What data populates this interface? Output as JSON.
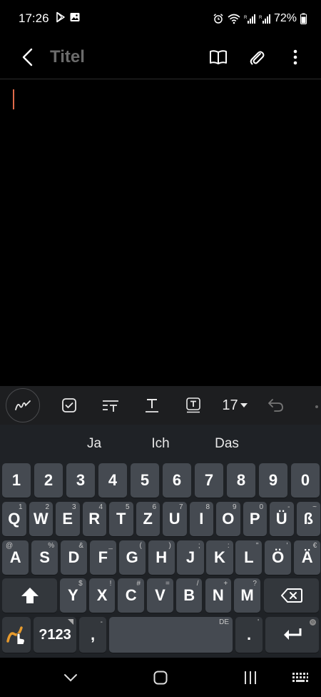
{
  "status": {
    "time": "17:26",
    "battery": "72%"
  },
  "app_bar": {
    "title": "Titel"
  },
  "toolbar": {
    "font_size": "17"
  },
  "keyboard": {
    "suggestions": [
      "Ja",
      "Ich",
      "Das"
    ],
    "rows": [
      [
        {
          "k": "1"
        },
        {
          "k": "2"
        },
        {
          "k": "3"
        },
        {
          "k": "4"
        },
        {
          "k": "5"
        },
        {
          "k": "6"
        },
        {
          "k": "7"
        },
        {
          "k": "8"
        },
        {
          "k": "9"
        },
        {
          "k": "0"
        }
      ],
      [
        {
          "k": "Q",
          "h": "1"
        },
        {
          "k": "W",
          "h": "2"
        },
        {
          "k": "E",
          "h": "3"
        },
        {
          "k": "R",
          "h": "4"
        },
        {
          "k": "T",
          "h": "5"
        },
        {
          "k": "Z",
          "h": "6"
        },
        {
          "k": "U",
          "h": "7"
        },
        {
          "k": "I",
          "h": "8"
        },
        {
          "k": "O",
          "h": "9"
        },
        {
          "k": "P",
          "h": "0"
        },
        {
          "k": "Ü",
          "h": "-"
        },
        {
          "k": "ß",
          "h": "~"
        }
      ],
      [
        {
          "k": "A",
          "hl": "@"
        },
        {
          "k": "S",
          "h": "%"
        },
        {
          "k": "D",
          "h": "&"
        },
        {
          "k": "F",
          "h": "_"
        },
        {
          "k": "G",
          "h": "("
        },
        {
          "k": "H",
          "h": ")"
        },
        {
          "k": "J",
          "h": ";"
        },
        {
          "k": "K",
          "h": ":"
        },
        {
          "k": "L",
          "h": "\""
        },
        {
          "k": "Ö",
          "h": "'"
        },
        {
          "k": "Ä",
          "h": "€"
        }
      ],
      [
        {
          "k": "Y",
          "h": "$"
        },
        {
          "k": "X",
          "h": "!"
        },
        {
          "k": "C",
          "h": "#"
        },
        {
          "k": "V",
          "h": "="
        },
        {
          "k": "B",
          "h": "/"
        },
        {
          "k": "N",
          "h": "+"
        },
        {
          "k": "M",
          "h": "?"
        }
      ]
    ],
    "sym_key": "?123",
    "comma_key": ",",
    "comma_hint": "-",
    "space_hint": "DE",
    "period_key": ".",
    "period_hint": "'"
  }
}
